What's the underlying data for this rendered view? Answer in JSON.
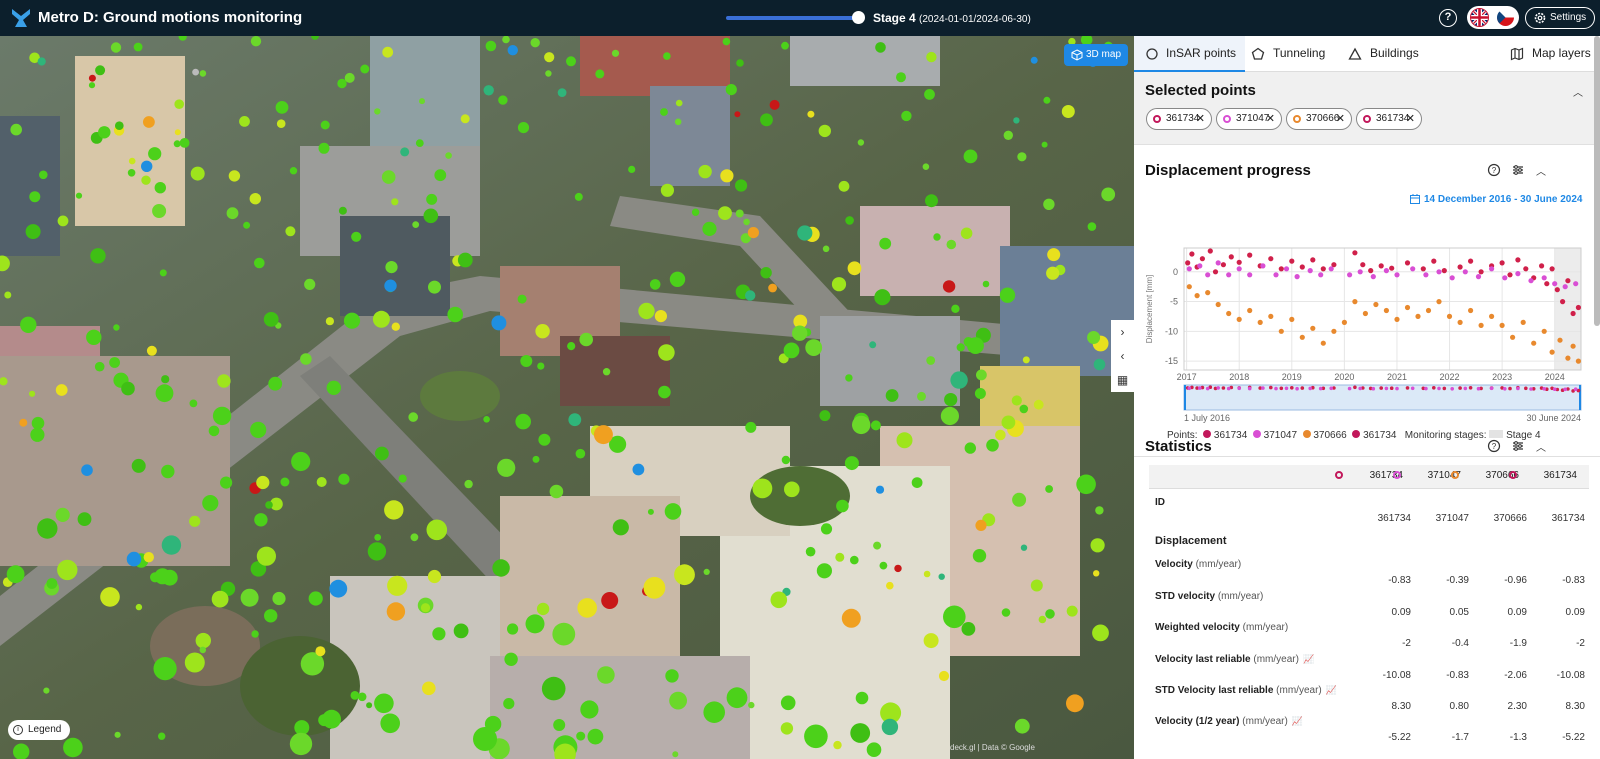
{
  "header": {
    "title": "Metro D: Ground motions monitoring",
    "stage_label": "Stage 4",
    "stage_range": "(2024-01-01/2024-06-30)",
    "help": "?",
    "settings": "Settings"
  },
  "map": {
    "btn_3d": "3D map",
    "legend": "Legend",
    "attribution": "deck.gl | Data © Google"
  },
  "tabs": [
    {
      "label": "InSAR points"
    },
    {
      "label": "Tunneling"
    },
    {
      "label": "Buildings"
    },
    {
      "label": "Map layers"
    }
  ],
  "selected": {
    "title": "Selected points",
    "chips": [
      {
        "id": "361734",
        "color": "#c2185b"
      },
      {
        "id": "371047",
        "color": "#d94fd4"
      },
      {
        "id": "370666",
        "color": "#e8892e"
      },
      {
        "id": "361734",
        "color": "#c2185b"
      }
    ]
  },
  "displacement": {
    "title": "Displacement progress",
    "date_range": "14 December 2016 - 30 June 2024",
    "legend_points": "Points:",
    "legend_stages": "Monitoring stages:",
    "legend_stage": "Stage 4"
  },
  "chart_data": {
    "type": "scatter",
    "ylabel": "Displacement [mm]",
    "x_ticks": [
      "2017",
      "2018",
      "2019",
      "2020",
      "2021",
      "2022",
      "2023",
      "2024"
    ],
    "y_ticks": [
      "0",
      "-5",
      "-10",
      "-15"
    ],
    "ylim": [
      -16.5,
      4
    ],
    "xlim": [
      2016.95,
      2024.5
    ],
    "brush_start": "1 July 2016",
    "brush_end": "30 June 2024",
    "stage_band": [
      2024.0,
      2024.5
    ],
    "series": [
      {
        "name": "361734",
        "color": "#d0204a",
        "values": [
          [
            2017.02,
            1.5
          ],
          [
            2017.1,
            3
          ],
          [
            2017.2,
            0.8
          ],
          [
            2017.3,
            2.2
          ],
          [
            2017.45,
            3.5
          ],
          [
            2017.55,
            0
          ],
          [
            2017.7,
            1.2
          ],
          [
            2017.85,
            2.5
          ],
          [
            2018.0,
            1.6
          ],
          [
            2018.2,
            2.8
          ],
          [
            2018.4,
            1.0
          ],
          [
            2018.6,
            2.2
          ],
          [
            2018.8,
            0.5
          ],
          [
            2019.0,
            1.8
          ],
          [
            2019.2,
            0.8
          ],
          [
            2019.4,
            2.0
          ],
          [
            2019.6,
            0.5
          ],
          [
            2019.8,
            1.2
          ],
          [
            2020.2,
            3.2
          ],
          [
            2020.35,
            1.2
          ],
          [
            2020.5,
            0.2
          ],
          [
            2020.7,
            1.0
          ],
          [
            2020.9,
            0.6
          ],
          [
            2021.2,
            1.5
          ],
          [
            2021.5,
            0.5
          ],
          [
            2021.7,
            1.8
          ],
          [
            2021.9,
            0.2
          ],
          [
            2022.2,
            0.8
          ],
          [
            2022.4,
            1.8
          ],
          [
            2022.6,
            0.0
          ],
          [
            2022.8,
            1.0
          ],
          [
            2023.0,
            1.5
          ],
          [
            2023.15,
            -0.5
          ],
          [
            2023.3,
            2.0
          ],
          [
            2023.45,
            0.5
          ],
          [
            2023.6,
            -1.0
          ],
          [
            2023.75,
            1.0
          ],
          [
            2023.85,
            -2.0
          ],
          [
            2023.95,
            0.5
          ],
          [
            2024.05,
            -3.0
          ],
          [
            2024.15,
            -5.0
          ],
          [
            2024.25,
            -1.5
          ],
          [
            2024.35,
            -7.0
          ],
          [
            2024.45,
            -6.0
          ]
        ]
      },
      {
        "name": "371047",
        "color": "#d94fd4",
        "values": [
          [
            2017.05,
            0.5
          ],
          [
            2017.25,
            1.0
          ],
          [
            2017.4,
            -0.5
          ],
          [
            2017.6,
            1.5
          ],
          [
            2017.8,
            -0.5
          ],
          [
            2018.0,
            0.5
          ],
          [
            2018.2,
            -0.5
          ],
          [
            2018.45,
            1.0
          ],
          [
            2018.7,
            -0.5
          ],
          [
            2018.9,
            0.5
          ],
          [
            2019.1,
            -0.8
          ],
          [
            2019.35,
            0.2
          ],
          [
            2019.55,
            -0.5
          ],
          [
            2019.75,
            0.5
          ],
          [
            2020.1,
            -0.5
          ],
          [
            2020.3,
            0.0
          ],
          [
            2020.55,
            -0.8
          ],
          [
            2020.8,
            0.2
          ],
          [
            2021.0,
            -0.5
          ],
          [
            2021.3,
            0.5
          ],
          [
            2021.55,
            -0.5
          ],
          [
            2021.8,
            0.0
          ],
          [
            2022.05,
            -1.0
          ],
          [
            2022.3,
            0.0
          ],
          [
            2022.55,
            -0.8
          ],
          [
            2022.8,
            0.5
          ],
          [
            2023.05,
            -1.0
          ],
          [
            2023.3,
            -0.3
          ],
          [
            2023.55,
            -1.5
          ],
          [
            2023.8,
            -1.0
          ],
          [
            2024.0,
            -2.0
          ],
          [
            2024.2,
            -2.5
          ],
          [
            2024.4,
            -2.0
          ]
        ]
      },
      {
        "name": "370666",
        "color": "#e8892e",
        "values": [
          [
            2017.05,
            -2.5
          ],
          [
            2017.2,
            -4.0
          ],
          [
            2017.4,
            -3.5
          ],
          [
            2017.6,
            -5.5
          ],
          [
            2017.8,
            -7.0
          ],
          [
            2018.0,
            -8.0
          ],
          [
            2018.2,
            -6.5
          ],
          [
            2018.4,
            -8.5
          ],
          [
            2018.6,
            -7.5
          ],
          [
            2018.8,
            -10.0
          ],
          [
            2019.0,
            -8.0
          ],
          [
            2019.2,
            -11.0
          ],
          [
            2019.4,
            -9.5
          ],
          [
            2019.6,
            -12.0
          ],
          [
            2019.8,
            -10.0
          ],
          [
            2020.0,
            -8.5
          ],
          [
            2020.2,
            -5.0
          ],
          [
            2020.4,
            -7.0
          ],
          [
            2020.6,
            -5.5
          ],
          [
            2020.8,
            -6.5
          ],
          [
            2021.0,
            -8.0
          ],
          [
            2021.2,
            -6.0
          ],
          [
            2021.4,
            -7.5
          ],
          [
            2021.6,
            -6.5
          ],
          [
            2021.8,
            -5.0
          ],
          [
            2022.0,
            -7.5
          ],
          [
            2022.2,
            -8.5
          ],
          [
            2022.4,
            -6.5
          ],
          [
            2022.6,
            -9.0
          ],
          [
            2022.8,
            -7.5
          ],
          [
            2023.0,
            -9.0
          ],
          [
            2023.2,
            -11.0
          ],
          [
            2023.4,
            -8.5
          ],
          [
            2023.6,
            -12.0
          ],
          [
            2023.8,
            -10.0
          ],
          [
            2023.95,
            -13.5
          ],
          [
            2024.1,
            -11.5
          ],
          [
            2024.25,
            -14.5
          ],
          [
            2024.35,
            -12.5
          ],
          [
            2024.45,
            -15.0
          ]
        ]
      }
    ]
  },
  "stats": {
    "title": "Statistics",
    "columns": [
      {
        "id": "361734",
        "color": "#c2185b"
      },
      {
        "id": "371047",
        "color": "#d94fd4"
      },
      {
        "id": "370666",
        "color": "#e8892e"
      },
      {
        "id": "361734",
        "color": "#c2185b"
      }
    ],
    "id_label": "ID",
    "group": "Displacement",
    "rows": [
      {
        "label": "ID",
        "unit": "",
        "values": [
          "361734",
          "371047",
          "370666",
          "361734"
        ]
      },
      {
        "label": "Velocity",
        "unit": "(mm/year)",
        "values": [
          "-0.83",
          "-0.39",
          "-0.96",
          "-0.83"
        ]
      },
      {
        "label": "STD velocity",
        "unit": "(mm/year)",
        "values": [
          "0.09",
          "0.05",
          "0.09",
          "0.09"
        ]
      },
      {
        "label": "Weighted velocity",
        "unit": "(mm/year)",
        "values": [
          "-2",
          "-0.4",
          "-1.9",
          "-2"
        ]
      },
      {
        "label": "Velocity last reliable",
        "unit": "(mm/year)",
        "values": [
          "-10.08",
          "-0.83",
          "-2.06",
          "-10.08"
        ],
        "icon": true
      },
      {
        "label": "STD Velocity last reliable",
        "unit": "(mm/year)",
        "values": [
          "8.30",
          "0.80",
          "2.30",
          "8.30"
        ],
        "icon": true
      },
      {
        "label": "Velocity (1/2 year)",
        "unit": "(mm/year)",
        "values": [
          "-5.22",
          "-1.7",
          "-1.3",
          "-5.22"
        ],
        "icon": true
      }
    ]
  }
}
